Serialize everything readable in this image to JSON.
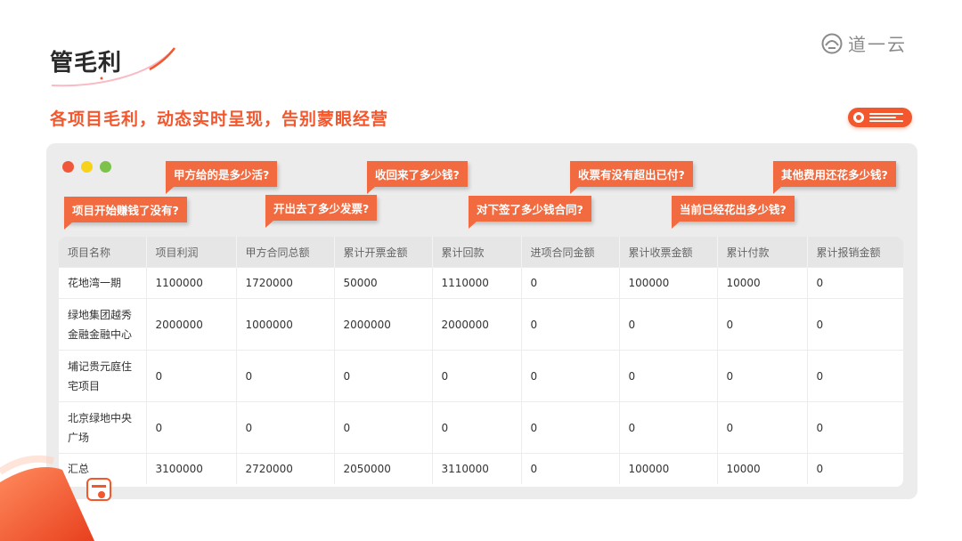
{
  "page": {
    "title": "管毛利",
    "subtitle": "各项目毛利，动态实时呈现，告别蒙眼经营",
    "brand": "道一云"
  },
  "colors": {
    "accent": "#f2572d",
    "tag": "#f26a3f",
    "panel": "#ececec"
  },
  "window": {
    "traffic_lights": [
      {
        "name": "close",
        "color": "#f0573a"
      },
      {
        "name": "minimize",
        "color": "#f7d21a"
      },
      {
        "name": "maximize",
        "color": "#7dc24a"
      }
    ]
  },
  "questions": [
    "项目开始赚钱了没有?",
    "甲方给的是多少活?",
    "开出去了多少发票?",
    "收回来了多少钱?",
    "对下签了多少钱合同?",
    "收票有没有超出已付?",
    "当前已经花出多少钱?",
    "其他费用还花多少钱?"
  ],
  "table": {
    "headers": [
      "项目名称",
      "项目利润",
      "甲方合同总额",
      "累计开票金额",
      "累计回款",
      "进项合同金额",
      "累计收票金额",
      "累计付款",
      "累计报销金额"
    ],
    "rows": [
      [
        "花地湾一期",
        "1100000",
        "1720000",
        "50000",
        "1110000",
        "0",
        "100000",
        "10000",
        "0"
      ],
      [
        "绿地集团越秀金融金融中心",
        "2000000",
        "1000000",
        "2000000",
        "2000000",
        "0",
        "0",
        "0",
        "0"
      ],
      [
        "埔记贵元庭住宅项目",
        "0",
        "0",
        "0",
        "0",
        "0",
        "0",
        "0",
        "0"
      ],
      [
        "北京绿地中央广场",
        "0",
        "0",
        "0",
        "0",
        "0",
        "0",
        "0",
        "0"
      ],
      [
        "汇总",
        "3100000",
        "2720000",
        "2050000",
        "3110000",
        "0",
        "100000",
        "10000",
        "0"
      ]
    ]
  }
}
